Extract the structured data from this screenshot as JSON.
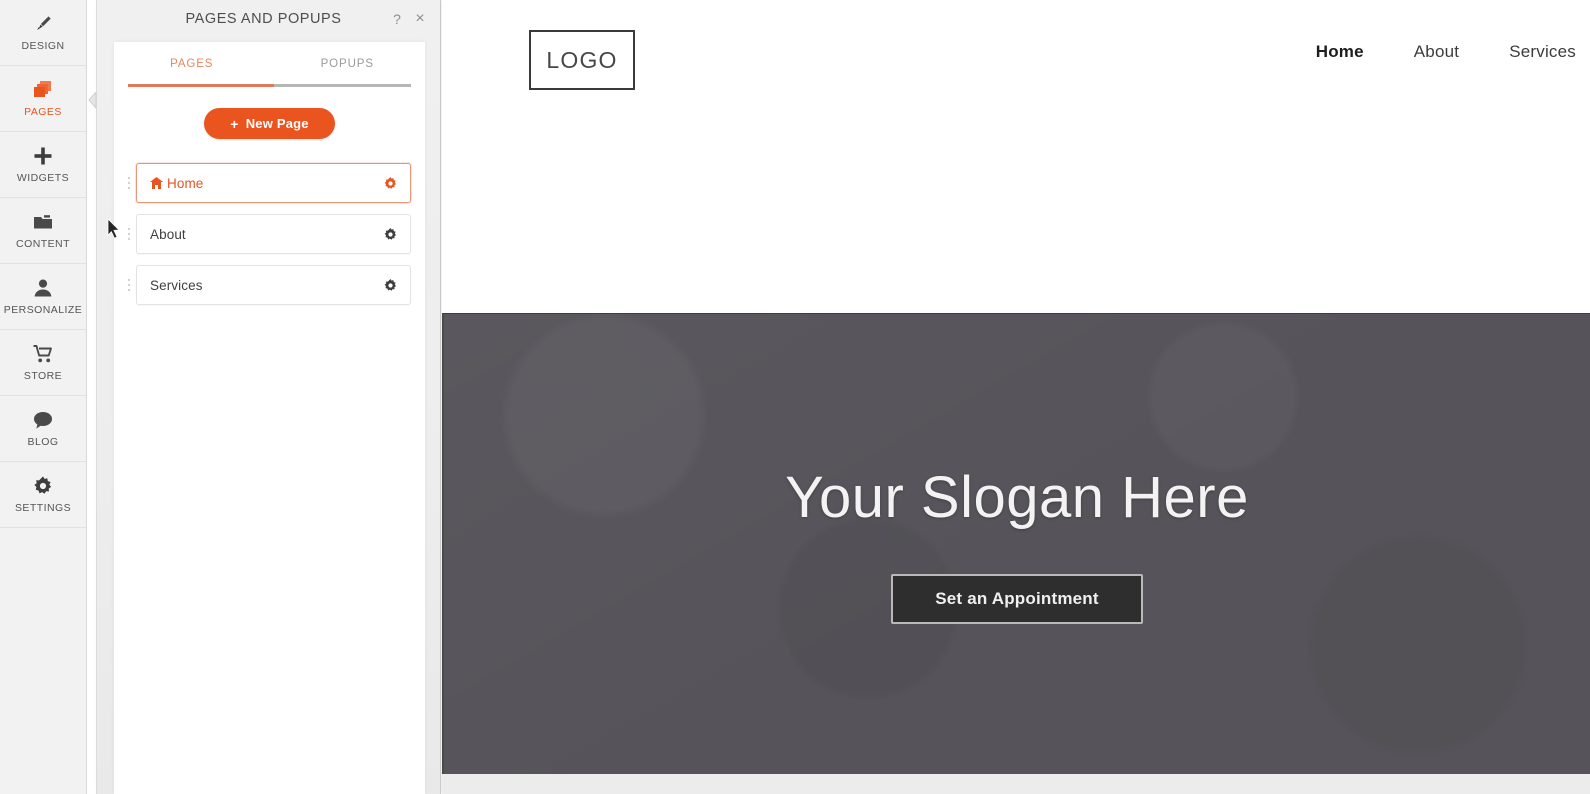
{
  "accent": "#ea541e",
  "rail": {
    "items": [
      {
        "label": "DESIGN",
        "icon": "brush-icon",
        "active": false
      },
      {
        "label": "PAGES",
        "icon": "pages-stack-icon",
        "active": true
      },
      {
        "label": "WIDGETS",
        "icon": "plus-icon",
        "active": false
      },
      {
        "label": "CONTENT",
        "icon": "folder-icon",
        "active": false
      },
      {
        "label": "PERSONALIZE",
        "icon": "person-icon",
        "active": false
      },
      {
        "label": "STORE",
        "icon": "cart-icon",
        "active": false
      },
      {
        "label": "BLOG",
        "icon": "chat-bubble-icon",
        "active": false
      },
      {
        "label": "SETTINGS",
        "icon": "gear-icon",
        "active": false
      }
    ]
  },
  "panel": {
    "title": "PAGES AND POPUPS",
    "help_label": "?",
    "close_label": "×",
    "tabs": [
      {
        "label": "PAGES",
        "active": true
      },
      {
        "label": "POPUPS",
        "active": false
      }
    ],
    "new_page": {
      "label": "New Page",
      "plus": "+"
    },
    "pages": [
      {
        "label": "Home",
        "selected": true,
        "home_icon": true,
        "gear": "gear-icon"
      },
      {
        "label": "About",
        "selected": false,
        "home_icon": false,
        "gear": "gear-icon"
      },
      {
        "label": "Services",
        "selected": false,
        "home_icon": false,
        "gear": "gear-icon"
      }
    ]
  },
  "preview": {
    "logo_text": "LOGO",
    "nav": [
      {
        "label": "Home",
        "active": true
      },
      {
        "label": "About",
        "active": false
      },
      {
        "label": "Services",
        "active": false
      }
    ],
    "hero": {
      "slogan": "Your Slogan Here",
      "cta_label": "Set an Appointment",
      "bg_color": "#56545a"
    }
  }
}
